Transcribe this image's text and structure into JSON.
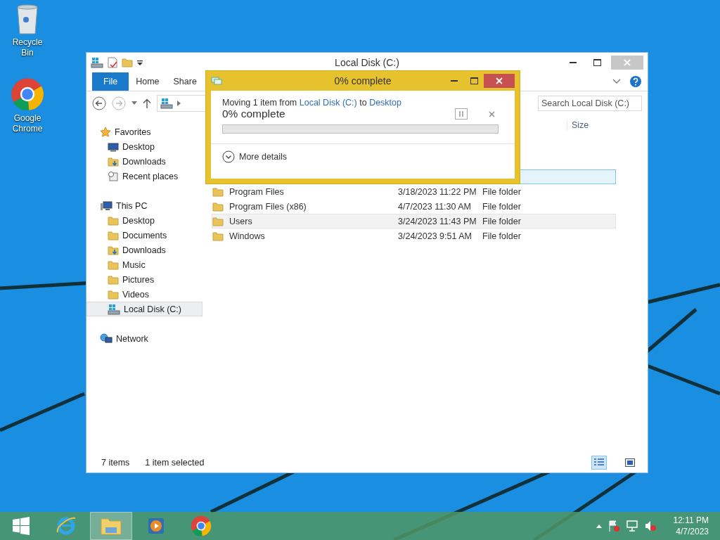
{
  "desktop_icons": [
    {
      "label": "Recycle Bin",
      "kind": "recycle"
    },
    {
      "label": "Google Chrome",
      "kind": "chrome"
    }
  ],
  "explorer": {
    "title": "Local Disk (C:)",
    "ribbon_tabs": [
      {
        "label": "File",
        "selected": true
      },
      {
        "label": "Home",
        "selected": false
      },
      {
        "label": "Share",
        "selected": false
      }
    ],
    "search": {
      "placeholder": "Search Local Disk (C:)"
    },
    "sidebar": [
      {
        "label": "Favorites",
        "kind": "star",
        "selected": false,
        "children": [
          {
            "label": "Desktop",
            "kind": "desktop",
            "selected": false
          },
          {
            "label": "Downloads",
            "kind": "downloads",
            "selected": false
          },
          {
            "label": "Recent places",
            "kind": "recent",
            "selected": false
          }
        ]
      },
      {
        "label": "This PC",
        "kind": "pc",
        "selected": false,
        "children": [
          {
            "label": "Desktop",
            "kind": "folder",
            "selected": false
          },
          {
            "label": "Documents",
            "kind": "folder",
            "selected": false
          },
          {
            "label": "Downloads",
            "kind": "downloads",
            "selected": false
          },
          {
            "label": "Music",
            "kind": "folder",
            "selected": false
          },
          {
            "label": "Pictures",
            "kind": "folder",
            "selected": false
          },
          {
            "label": "Videos",
            "kind": "folder",
            "selected": false
          },
          {
            "label": "Local Disk (C:)",
            "kind": "drive",
            "selected": true
          }
        ]
      },
      {
        "label": "Network",
        "kind": "network",
        "selected": false
      }
    ],
    "columns": [
      "Size"
    ],
    "rows": [
      {
        "name": "Program Files",
        "date": "3/18/2023 11:22 PM",
        "type": "File folder",
        "hovered": false
      },
      {
        "name": "Program Files (x86)",
        "date": "4/7/2023 11:30 AM",
        "type": "File folder",
        "hovered": false
      },
      {
        "name": "Users",
        "date": "3/24/2023 11:43 PM",
        "type": "File folder",
        "hovered": true
      },
      {
        "name": "Windows",
        "date": "3/24/2023 9:51 AM",
        "type": "File folder",
        "hovered": false
      }
    ],
    "status": {
      "count": "7 items",
      "selection": "1 item selected"
    }
  },
  "dialog": {
    "title": "0% complete",
    "prefix": "Moving 1 item from",
    "source": "Local Disk (C:)",
    "middle": "to",
    "destination": "Desktop",
    "progress_text": "0% complete",
    "level": 0,
    "more_details": "More details"
  },
  "taskbar": {
    "apps": [
      {
        "kind": "start",
        "selected": false
      },
      {
        "kind": "ie",
        "selected": false
      },
      {
        "kind": "explorer",
        "selected": true
      },
      {
        "kind": "media",
        "selected": false
      },
      {
        "kind": "chrome",
        "selected": false
      }
    ],
    "time": "12:11 PM",
    "date": "4/7/2023"
  }
}
